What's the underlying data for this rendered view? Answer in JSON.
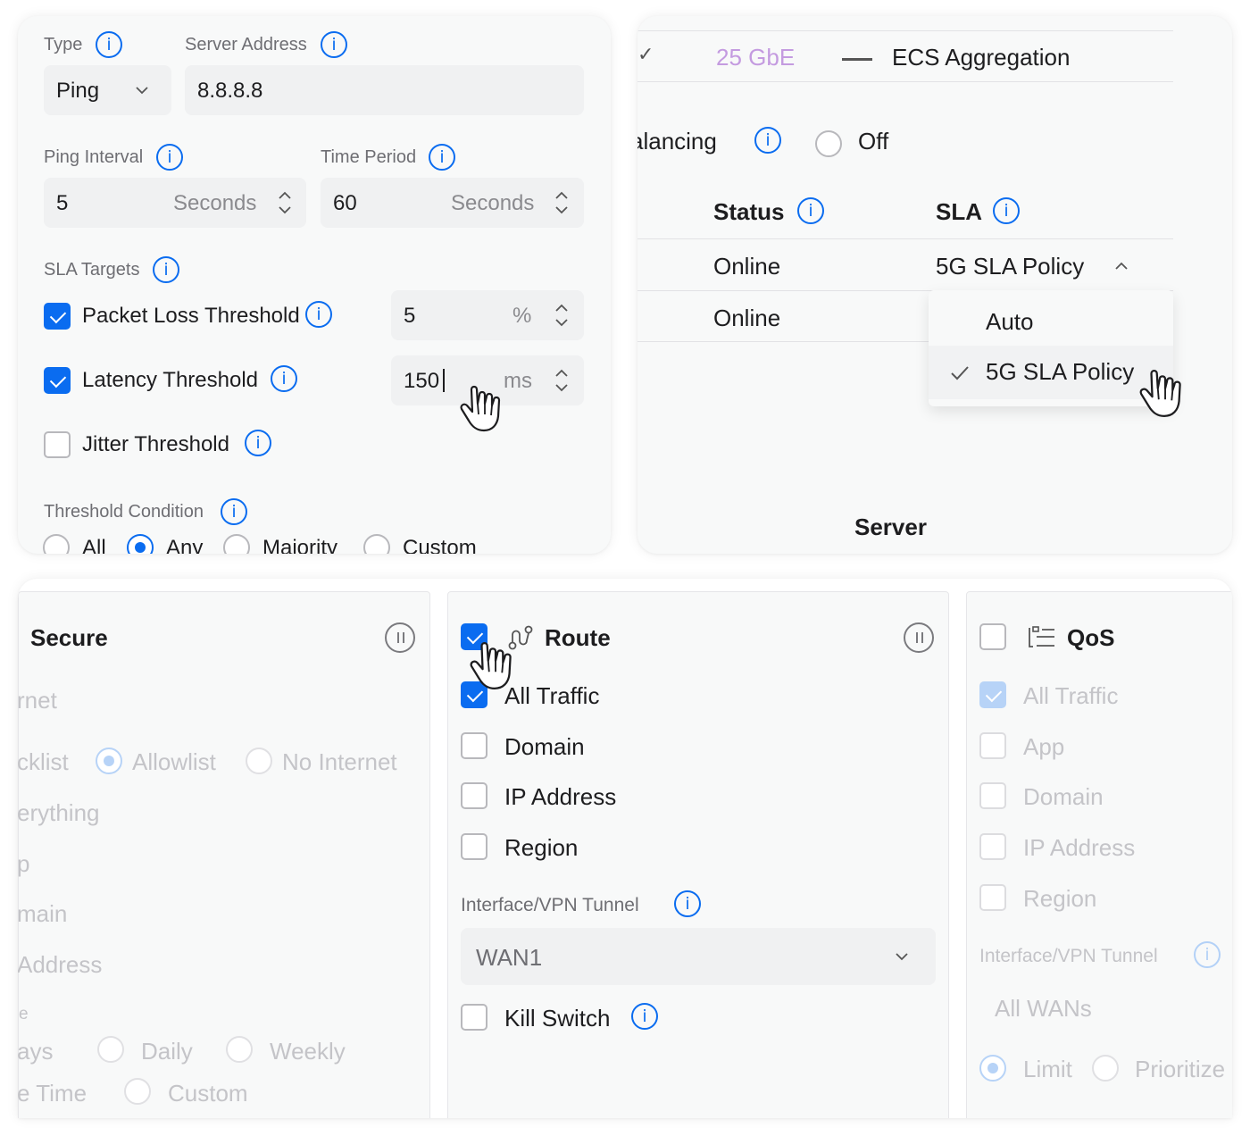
{
  "sla_form": {
    "type_label": "Type",
    "type_value": "Ping",
    "server_label": "Server Address",
    "server_value": "8.8.8.8",
    "ping_interval_label": "Ping Interval",
    "ping_interval_value": "5",
    "ping_interval_unit": "Seconds",
    "time_period_label": "Time Period",
    "time_period_value": "60",
    "time_period_unit": "Seconds",
    "sla_targets_label": "SLA Targets",
    "packet_loss_label": "Packet Loss Threshold",
    "packet_loss_checked": true,
    "packet_loss_value": "5",
    "packet_loss_unit": "%",
    "latency_label": "Latency Threshold",
    "latency_checked": true,
    "latency_value": "150",
    "latency_unit": "ms",
    "jitter_label": "Jitter Threshold",
    "jitter_checked": false,
    "condition_label": "Threshold Condition",
    "condition_options": [
      "All",
      "Any",
      "Majority",
      "Custom"
    ],
    "condition_selected": "Any"
  },
  "wan_panel": {
    "speed": "25 GbE",
    "aggregation": "ECS Aggregation",
    "balancing_label": "alancing",
    "balancing_option": "Off",
    "col_status": "Status",
    "col_sla": "SLA",
    "row1_status": "Online",
    "row1_sla": "5G SLA Policy",
    "row2_status": "Online",
    "dropdown_options": [
      "Auto",
      "5G SLA Policy"
    ],
    "dropdown_selected": "5G SLA Policy",
    "footer": "Server"
  },
  "secure_card": {
    "title": "Secure",
    "items": [
      "rnet",
      "cklist",
      "Allowlist",
      "No Internet",
      "erything",
      "p",
      "main",
      "Address",
      "e",
      "ays",
      "Daily",
      "Weekly",
      "e Time",
      "Custom"
    ]
  },
  "route_card": {
    "title": "Route",
    "checked": true,
    "options": [
      {
        "label": "All Traffic",
        "checked": true
      },
      {
        "label": "Domain",
        "checked": false
      },
      {
        "label": "IP Address",
        "checked": false
      },
      {
        "label": "Region",
        "checked": false
      }
    ],
    "interface_label": "Interface/VPN Tunnel",
    "interface_value": "WAN1",
    "kill_switch_label": "Kill Switch"
  },
  "qos_card": {
    "title": "QoS",
    "checked": false,
    "options": [
      {
        "label": "All Traffic",
        "checked": true
      },
      {
        "label": "App",
        "checked": false
      },
      {
        "label": "Domain",
        "checked": false
      },
      {
        "label": "IP Address",
        "checked": false
      },
      {
        "label": "Region",
        "checked": false
      }
    ],
    "interface_label": "Interface/VPN Tunnel",
    "interface_value": "All WANs",
    "mode_options": [
      "Limit",
      "Prioritize"
    ],
    "mode_selected": "Limit"
  },
  "colors": {
    "accent": "#0a6cf0",
    "speed_text": "#c49be0",
    "faded": "#c4c4c8"
  }
}
